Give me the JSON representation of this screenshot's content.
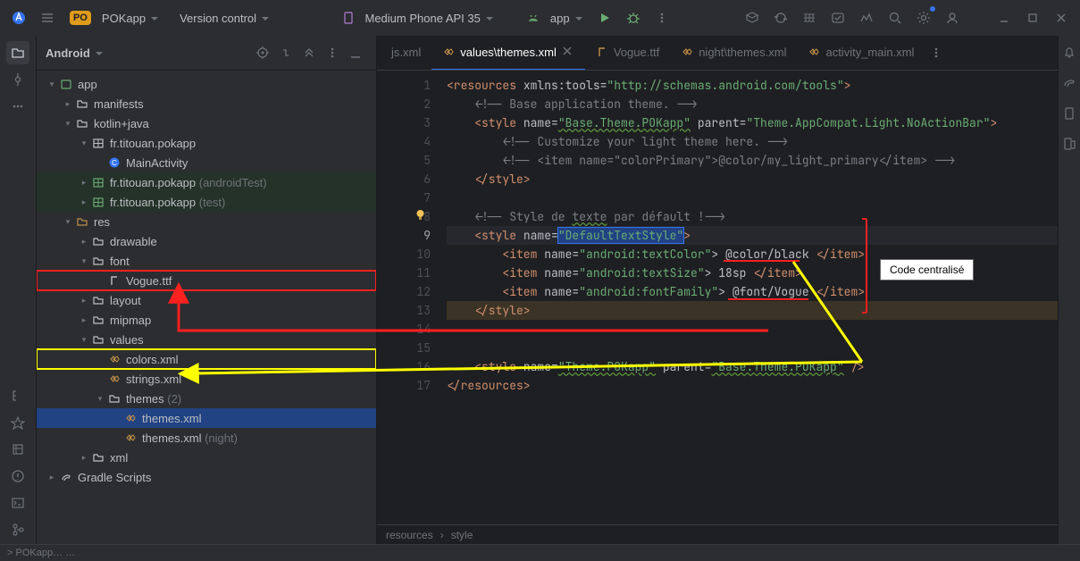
{
  "topbar": {
    "project_badge": "PO",
    "project_name": "POKapp",
    "vcs_label": "Version control",
    "device_label": "Medium Phone API 35",
    "run_config_label": "app"
  },
  "project_panel": {
    "title": "Android"
  },
  "tree": {
    "app": "app",
    "manifests": "manifests",
    "kotlinjava": "kotlin+java",
    "pkg_main": "fr.titouan.pokapp",
    "main_activity": "MainActivity",
    "pkg_test": "fr.titouan.pokapp",
    "pkg_test_suffix": " (androidTest)",
    "pkg_unit": "fr.titouan.pokapp",
    "pkg_unit_suffix": " (test)",
    "res": "res",
    "drawable": "drawable",
    "font": "font",
    "vogue": "Vogue.ttf",
    "layout": "layout",
    "mipmap": "mipmap",
    "values": "values",
    "colors": "colors.xml",
    "strings": "strings.xml",
    "themes_dir": "themes",
    "themes_count": " (2)",
    "themes_light": "themes.xml",
    "themes_night": "themes.xml",
    "themes_night_suffix": " (night)",
    "xml": "xml",
    "gradle": "Gradle Scripts"
  },
  "tabs": {
    "t0": "js.xml",
    "t1": "values\\themes.xml",
    "t2": "Vogue.ttf",
    "t3": "night\\themes.xml",
    "t4": "activity_main.xml"
  },
  "code": {
    "lines": [
      "1",
      "2",
      "3",
      "4",
      "5",
      "6",
      "7",
      "8",
      "9",
      "10",
      "11",
      "12",
      "13",
      "14",
      "15",
      "16",
      "17"
    ],
    "l1_a": "<resources",
    "l1_b": " xmlns:tools=",
    "l1_c": "\"http://schemas.android.com/tools\"",
    "l1_d": ">",
    "l2": "    <!-- Base application theme. -->",
    "l3_a": "    <style",
    "l3_b": " name=",
    "l3_c": "\"Base.Theme.POKapp\"",
    "l3_d": " parent=",
    "l3_e": "\"Theme.AppCompat.Light.NoActionBar\"",
    "l3_f": ">",
    "l4": "        <!-- Customize your light theme here. -->",
    "l5": "        <!-- <item name=\"colorPrimary\">@color/my_light_primary</item> -->",
    "l6": "    </style>",
    "l8_a": "    <!-- Style de ",
    "l8_b": "texte",
    "l8_c": " par défault !-->",
    "l9_a": "    <style",
    "l9_b": " name=",
    "l9_c": "\"DefaultTextStyle\"",
    "l9_d": ">",
    "l10_a": "        <item",
    "l10_b": " name=",
    "l10_c": "\"android:textColor\"",
    "l10_d": "> @color/black ",
    "l10_e": "</item>",
    "l11_a": "        <item",
    "l11_b": " name=",
    "l11_c": "\"android:textSize\"",
    "l11_d": "> 18sp ",
    "l11_e": "</item>",
    "l12_a": "        <item",
    "l12_b": " name=",
    "l12_c": "\"android:fontFamily\"",
    "l12_d": "> @font/Vogue ",
    "l12_e": "</item>",
    "l13": "    </style>",
    "l16_a": "    <style",
    "l16_b": " name=",
    "l16_c": "\"Theme.POKapp\"",
    "l16_d": " parent=",
    "l16_e": "\"Base.Theme.POKapp\"",
    "l16_f": " />",
    "l17": "</resources>"
  },
  "breadcrumb": {
    "a": "resources",
    "sep": "›",
    "b": "style"
  },
  "status": {
    "left": "> POKapp… …"
  },
  "annotation": {
    "label": "Code centralisé"
  }
}
